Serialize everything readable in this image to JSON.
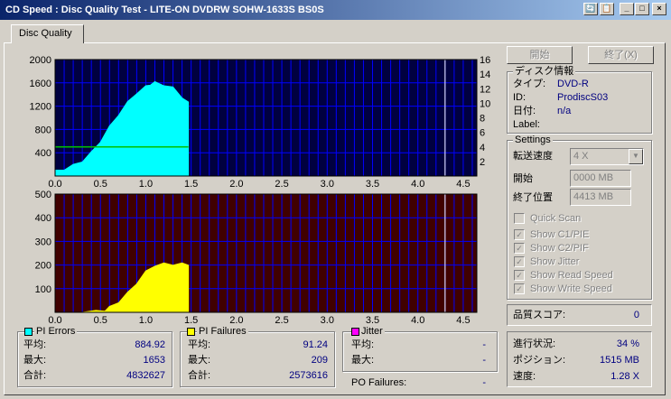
{
  "window": {
    "title": "CD Speed : Disc Quality Test - LITE-ON DVDRW SOHW-1633S BS0S",
    "controls": [
      "🔄",
      "📋",
      "_",
      "□",
      "×"
    ]
  },
  "tab": "Disc Quality",
  "buttons": {
    "start": "開始",
    "stop": "終了(X)"
  },
  "disc_info": {
    "title": "ディスク情報",
    "type_label": "タイプ:",
    "type_value": "DVD-R",
    "id_label": "ID:",
    "id_value": "ProdiscS03",
    "date_label": "日付:",
    "date_value": "n/a",
    "label_label": "Label:",
    "label_value": ""
  },
  "settings": {
    "title": "Settings",
    "speed_label": "転送速度",
    "speed_value": "4 X",
    "start_label": "開始",
    "start_value": "0000 MB",
    "end_label": "終了位置",
    "end_value": "4413 MB",
    "checks": [
      {
        "label": "Quick Scan",
        "checked": false
      },
      {
        "label": "Show C1/PIE",
        "checked": true
      },
      {
        "label": "Show C2/PIF",
        "checked": true
      },
      {
        "label": "Show Jitter",
        "checked": true
      },
      {
        "label": "Show Read Speed",
        "checked": true
      },
      {
        "label": "Show Write Speed",
        "checked": true
      }
    ]
  },
  "quality": {
    "label": "品質スコア:",
    "value": "0"
  },
  "progress": {
    "progress_label": "進行状況:",
    "progress_value": "34 %",
    "position_label": "ポジション:",
    "position_value": "1515 MB",
    "speed_label": "速度:",
    "speed_value": "1.28 X"
  },
  "stats": {
    "pi_errors": {
      "title": "PI Errors",
      "color": "#00ffff",
      "avg_label": "平均:",
      "avg": "884.92",
      "max_label": "最大:",
      "max": "1653",
      "total_label": "合計:",
      "total": "4832627"
    },
    "pi_failures": {
      "title": "PI Failures",
      "color": "#ffff00",
      "avg_label": "平均:",
      "avg": "91.24",
      "max_label": "最大:",
      "max": "209",
      "total_label": "合計:",
      "total": "2573616"
    },
    "jitter": {
      "title": "Jitter",
      "color": "#ff00ff",
      "avg_label": "平均:",
      "avg": "-",
      "max_label": "最大:",
      "max": "-"
    },
    "po_failures": {
      "label": "PO Failures:",
      "value": "-"
    }
  },
  "chart_data": [
    {
      "type": "area",
      "series": [
        {
          "name": "PI Errors",
          "color": "#00ffff",
          "x": [
            0.0,
            0.1,
            0.2,
            0.3,
            0.4,
            0.5,
            0.6,
            0.7,
            0.8,
            0.9,
            1.0,
            1.05,
            1.1,
            1.2,
            1.3,
            1.4,
            1.47
          ],
          "y": [
            100,
            140,
            200,
            280,
            420,
            620,
            860,
            1080,
            1280,
            1450,
            1550,
            1600,
            1620,
            1590,
            1530,
            1380,
            1270
          ]
        }
      ],
      "x_ticks": [
        "0.0",
        "0.5",
        "1.0",
        "1.5",
        "2.0",
        "2.5",
        "3.0",
        "3.5",
        "4.0",
        "4.5"
      ],
      "y_ticks": [
        "2000",
        "1600",
        "1200",
        "800",
        "400"
      ],
      "y2_ticks": [
        "16",
        "14",
        "12",
        "10",
        "8",
        "6",
        "4",
        "2"
      ],
      "xlim": [
        0,
        4.65
      ],
      "ylim": [
        0,
        2000
      ],
      "y2lim": [
        0,
        16
      ],
      "speed_line": {
        "color": "#00c000",
        "y": 500,
        "x_end": 1.47
      },
      "marker_x": 4.3,
      "grid": true,
      "background": "#000040",
      "grid_color": "#0000ff"
    },
    {
      "type": "area",
      "series": [
        {
          "name": "PI Failures",
          "color": "#ffff00",
          "x": [
            0.0,
            0.3,
            0.45,
            0.55,
            0.6,
            0.7,
            0.8,
            0.9,
            1.0,
            1.1,
            1.2,
            1.3,
            1.4,
            1.47
          ],
          "y": [
            0,
            3,
            8,
            15,
            25,
            50,
            85,
            130,
            175,
            205,
            209,
            209,
            209,
            209
          ]
        }
      ],
      "x_ticks": [
        "0.0",
        "0.5",
        "1.0",
        "1.5",
        "2.0",
        "2.5",
        "3.0",
        "3.5",
        "4.0",
        "4.5"
      ],
      "y_ticks": [
        "500",
        "400",
        "300",
        "200",
        "100"
      ],
      "xlim": [
        0,
        4.65
      ],
      "ylim": [
        0,
        500
      ],
      "marker_x": 4.3,
      "grid": true,
      "background": "#400000",
      "grid_color": "#0000ff"
    }
  ]
}
